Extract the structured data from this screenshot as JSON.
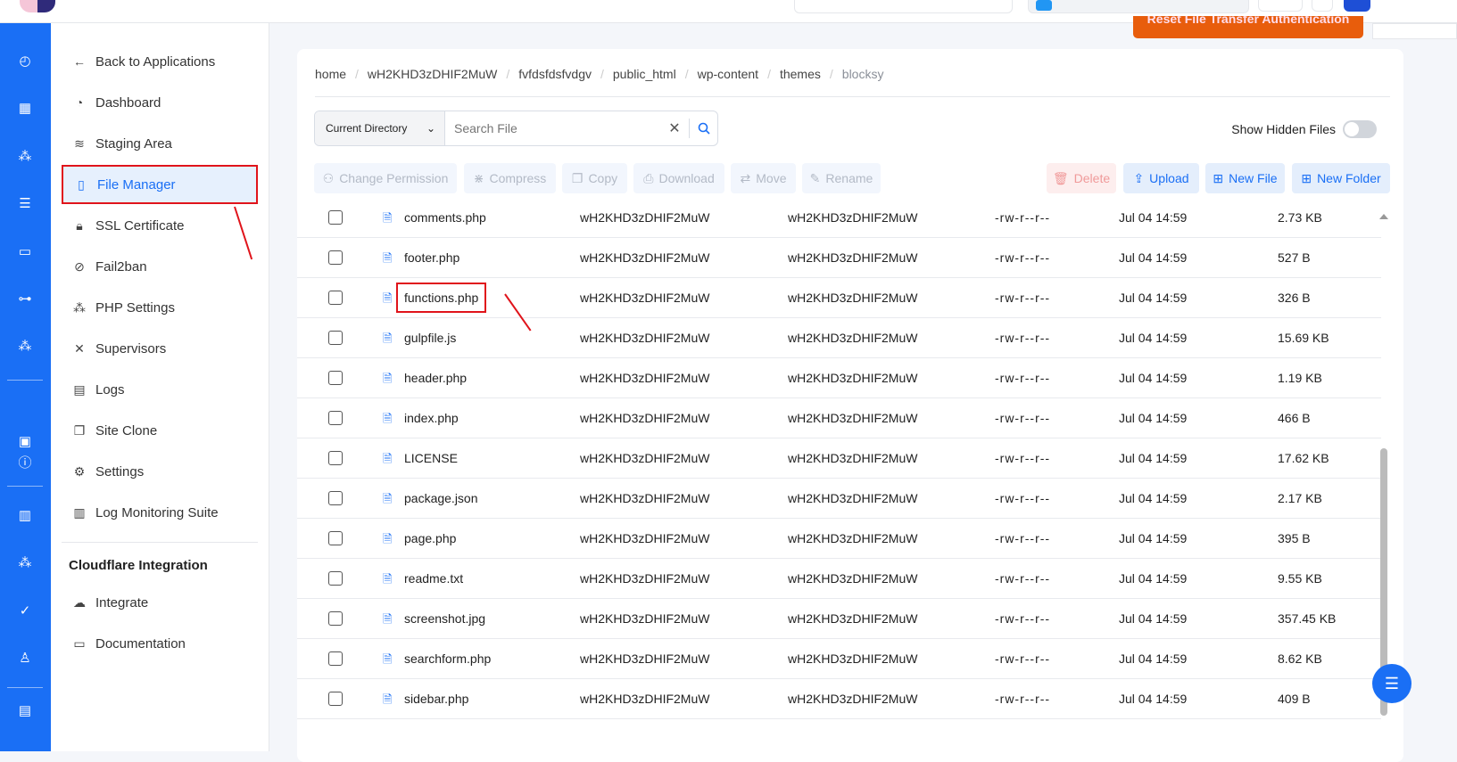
{
  "topbar": {
    "orange_button": "Reset File Transfer Authentication"
  },
  "sidebar": {
    "items": [
      {
        "label": "Back to Applications",
        "icon": "arrow-left-icon",
        "glyph": "←"
      },
      {
        "label": "Dashboard",
        "icon": "gauge-icon",
        "glyph": "◔"
      },
      {
        "label": "Staging Area",
        "icon": "layers-icon",
        "glyph": "≋"
      },
      {
        "label": "File Manager",
        "icon": "file-icon",
        "glyph": "▯",
        "active": true
      },
      {
        "label": "SSL Certificate",
        "icon": "lock-icon",
        "glyph": "🔒︎"
      },
      {
        "label": "Fail2ban",
        "icon": "ban-icon",
        "glyph": "⊘"
      },
      {
        "label": "PHP Settings",
        "icon": "cubes-icon",
        "glyph": "⁂"
      },
      {
        "label": "Supervisors",
        "icon": "tools-icon",
        "glyph": "✕"
      },
      {
        "label": "Logs",
        "icon": "document-icon",
        "glyph": "▤"
      },
      {
        "label": "Site Clone",
        "icon": "copy-icon",
        "glyph": "❐"
      },
      {
        "label": "Settings",
        "icon": "gear-icon",
        "glyph": "⚙"
      },
      {
        "label": "Log Monitoring Suite",
        "icon": "chart-icon",
        "glyph": "▥"
      }
    ],
    "section_title": "Cloudflare Integration",
    "cf_items": [
      {
        "label": "Integrate",
        "icon": "cloud-icon",
        "glyph": "☁"
      },
      {
        "label": "Documentation",
        "icon": "book-icon",
        "glyph": "▭"
      }
    ]
  },
  "breadcrumb": [
    "home",
    "wH2KHD3zDHIF2MuW",
    "fvfdsfdsfvdgv",
    "public_html",
    "wp-content",
    "themes",
    "blocksy"
  ],
  "search": {
    "scope": "Current Directory",
    "placeholder": "Search File",
    "value": ""
  },
  "show_hidden": {
    "label": "Show Hidden Files",
    "on": false
  },
  "actions": {
    "change_permission": "Change Permission",
    "compress": "Compress",
    "copy": "Copy",
    "download": "Download",
    "move": "Move",
    "rename": "Rename",
    "delete": "Delete",
    "upload": "Upload",
    "new_file": "New File",
    "new_folder": "New Folder"
  },
  "files": [
    {
      "name": "comments.php",
      "owner": "wH2KHD3zDHIF2MuW",
      "group": "wH2KHD3zDHIF2MuW",
      "perms": "-rw-r--r--",
      "date": "Jul 04 14:59",
      "size": "2.73 KB"
    },
    {
      "name": "footer.php",
      "owner": "wH2KHD3zDHIF2MuW",
      "group": "wH2KHD3zDHIF2MuW",
      "perms": "-rw-r--r--",
      "date": "Jul 04 14:59",
      "size": "527 B"
    },
    {
      "name": "functions.php",
      "owner": "wH2KHD3zDHIF2MuW",
      "group": "wH2KHD3zDHIF2MuW",
      "perms": "-rw-r--r--",
      "date": "Jul 04 14:59",
      "size": "326 B",
      "highlighted": true
    },
    {
      "name": "gulpfile.js",
      "owner": "wH2KHD3zDHIF2MuW",
      "group": "wH2KHD3zDHIF2MuW",
      "perms": "-rw-r--r--",
      "date": "Jul 04 14:59",
      "size": "15.69 KB"
    },
    {
      "name": "header.php",
      "owner": "wH2KHD3zDHIF2MuW",
      "group": "wH2KHD3zDHIF2MuW",
      "perms": "-rw-r--r--",
      "date": "Jul 04 14:59",
      "size": "1.19 KB"
    },
    {
      "name": "index.php",
      "owner": "wH2KHD3zDHIF2MuW",
      "group": "wH2KHD3zDHIF2MuW",
      "perms": "-rw-r--r--",
      "date": "Jul 04 14:59",
      "size": "466 B"
    },
    {
      "name": "LICENSE",
      "owner": "wH2KHD3zDHIF2MuW",
      "group": "wH2KHD3zDHIF2MuW",
      "perms": "-rw-r--r--",
      "date": "Jul 04 14:59",
      "size": "17.62 KB"
    },
    {
      "name": "package.json",
      "owner": "wH2KHD3zDHIF2MuW",
      "group": "wH2KHD3zDHIF2MuW",
      "perms": "-rw-r--r--",
      "date": "Jul 04 14:59",
      "size": "2.17 KB"
    },
    {
      "name": "page.php",
      "owner": "wH2KHD3zDHIF2MuW",
      "group": "wH2KHD3zDHIF2MuW",
      "perms": "-rw-r--r--",
      "date": "Jul 04 14:59",
      "size": "395 B"
    },
    {
      "name": "readme.txt",
      "owner": "wH2KHD3zDHIF2MuW",
      "group": "wH2KHD3zDHIF2MuW",
      "perms": "-rw-r--r--",
      "date": "Jul 04 14:59",
      "size": "9.55 KB"
    },
    {
      "name": "screenshot.jpg",
      "owner": "wH2KHD3zDHIF2MuW",
      "group": "wH2KHD3zDHIF2MuW",
      "perms": "-rw-r--r--",
      "date": "Jul 04 14:59",
      "size": "357.45 KB"
    },
    {
      "name": "searchform.php",
      "owner": "wH2KHD3zDHIF2MuW",
      "group": "wH2KHD3zDHIF2MuW",
      "perms": "-rw-r--r--",
      "date": "Jul 04 14:59",
      "size": "8.62 KB"
    },
    {
      "name": "sidebar.php",
      "owner": "wH2KHD3zDHIF2MuW",
      "group": "wH2KHD3zDHIF2MuW",
      "perms": "-rw-r--r--",
      "date": "Jul 04 14:59",
      "size": "409 B"
    }
  ],
  "colors": {
    "accent": "#1a6ff5",
    "highlight": "#e0141b",
    "orange": "#e85d0c"
  }
}
